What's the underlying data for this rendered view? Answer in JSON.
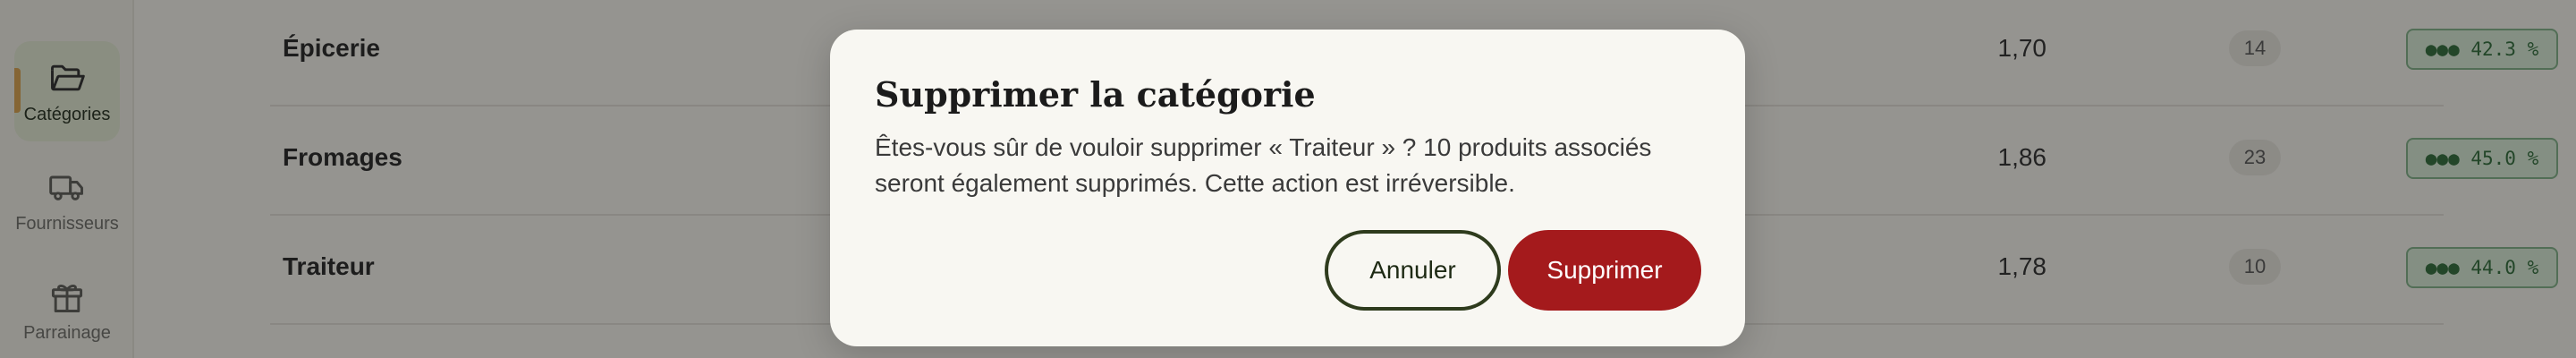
{
  "sidebar": {
    "items": [
      {
        "label": "Catégories",
        "icon": "folder-open-icon",
        "active": true
      },
      {
        "label": "Fournisseurs",
        "icon": "truck-icon",
        "active": false
      },
      {
        "label": "Parrainage",
        "icon": "gift-icon",
        "active": false
      }
    ]
  },
  "table": {
    "rows": [
      {
        "name": "Épicerie",
        "price": "1,70",
        "count": "14",
        "margin": "42.3 %"
      },
      {
        "name": "Fromages",
        "price": "1,86",
        "count": "23",
        "margin": "45.0 %"
      },
      {
        "name": "Traiteur",
        "price": "1,78",
        "count": "10",
        "margin": "44.0 %"
      }
    ],
    "margin_dots": "●●●",
    "more_label": "•••"
  },
  "dialog": {
    "title": "Supprimer la catégorie",
    "message": "Êtes-vous sûr de vouloir supprimer « Traiteur » ? 10 produits associés seront également supprimés. Cette action est irréversible.",
    "cancel_label": "Annuler",
    "confirm_label": "Supprimer"
  },
  "colors": {
    "accent": "#d9a04a",
    "danger": "#a41a1c",
    "badge_green": "#2c6a36",
    "active_nav_bg": "#e3ead2"
  }
}
